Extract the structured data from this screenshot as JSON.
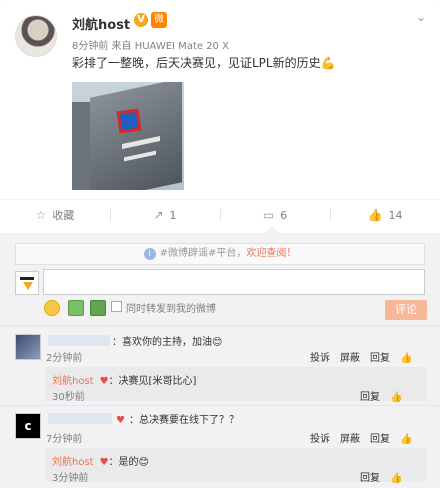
{
  "post": {
    "username": "刘航host",
    "vip_mark": "V",
    "badge": "微",
    "meta": "8分钟前 来自 HUAWEI Mate 20 X",
    "text": "彩排了一整晚，后天决赛见，见证LPL新的历史💪",
    "image_alt": "photo of building with sign"
  },
  "actions": {
    "favorite": "收藏",
    "repost_count": "1",
    "comment_count": "6",
    "like_count": "14"
  },
  "notice": {
    "prefix": "#微博辟谣#平台，",
    "link": "欢迎查阅！"
  },
  "composer": {
    "placeholder": "",
    "forward_label": "同时转发到我的微博",
    "submit_label": "评论"
  },
  "comments": [
    {
      "text": "：喜欢你的主持，加油😊",
      "time": "2分钟前",
      "ops": [
        "投诉",
        "屏蔽",
        "回复",
        "赞"
      ],
      "reply": {
        "name": "刘航host",
        "text": "：决赛见[米哥比心]",
        "time": "30秒前",
        "ops": [
          "回复",
          "赞"
        ]
      }
    },
    {
      "text": "：总决赛要在线下了？？",
      "time": "7分钟前",
      "avatar_letter": "c",
      "ops": [
        "投诉",
        "屏蔽",
        "回复",
        "赞"
      ],
      "reply": {
        "name": "刘航host",
        "text": "：是的😊",
        "time": "3分钟前",
        "ops": [
          "回复",
          "赞"
        ]
      }
    }
  ],
  "colors": {
    "accent": "#eb7350",
    "link": "#eb7350",
    "submit": "#f7b89a"
  }
}
